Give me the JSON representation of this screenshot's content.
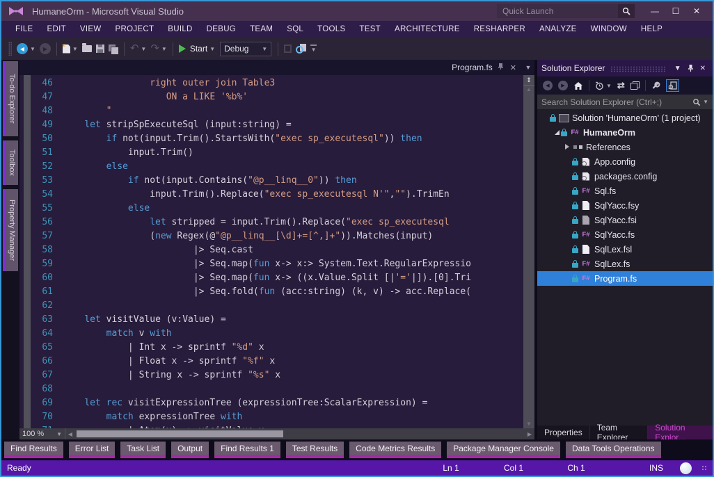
{
  "window": {
    "title": "HumaneOrm - Microsoft Visual Studio"
  },
  "titlebar": {
    "quick_launch": "Quick Launch"
  },
  "menus": [
    "FILE",
    "EDIT",
    "VIEW",
    "PROJECT",
    "BUILD",
    "DEBUG",
    "TEAM",
    "SQL",
    "TOOLS",
    "TEST",
    "ARCHITECTURE",
    "RESHARPER",
    "ANALYZE",
    "WINDOW",
    "HELP"
  ],
  "toolbar": {
    "start_label": "Start",
    "config_value": "Debug"
  },
  "left_tabs": [
    "To-do Explorer",
    "Toolbox",
    "Property Manager"
  ],
  "editor": {
    "tab": "Program.fs",
    "zoom": "100 %",
    "lines": [
      {
        "n": 46,
        "seg": [
          {
            "c": "s",
            "t": "                right outer join Table3"
          }
        ]
      },
      {
        "n": 47,
        "seg": [
          {
            "c": "s",
            "t": "                   ON a LIKE '%b%'"
          }
        ]
      },
      {
        "n": 48,
        "seg": [
          {
            "c": "s",
            "t": "        \""
          }
        ]
      },
      {
        "n": 49,
        "seg": [
          {
            "c": "d",
            "t": "    "
          },
          {
            "c": "k",
            "t": "let"
          },
          {
            "c": "d",
            "t": " stripSpExecuteSql (input:string) ="
          }
        ]
      },
      {
        "n": 50,
        "seg": [
          {
            "c": "d",
            "t": "        "
          },
          {
            "c": "k",
            "t": "if"
          },
          {
            "c": "d",
            "t": " not(input.Trim().StartsWith("
          },
          {
            "c": "s",
            "t": "\"exec sp_executesql\""
          },
          {
            "c": "d",
            "t": ")) "
          },
          {
            "c": "k",
            "t": "then"
          }
        ]
      },
      {
        "n": 51,
        "seg": [
          {
            "c": "d",
            "t": "            input.Trim()"
          }
        ]
      },
      {
        "n": 52,
        "seg": [
          {
            "c": "d",
            "t": "        "
          },
          {
            "c": "k",
            "t": "else"
          }
        ]
      },
      {
        "n": 53,
        "seg": [
          {
            "c": "d",
            "t": "            "
          },
          {
            "c": "k",
            "t": "if"
          },
          {
            "c": "d",
            "t": " not(input.Contains("
          },
          {
            "c": "s",
            "t": "\"@p__linq__0\""
          },
          {
            "c": "d",
            "t": ")) "
          },
          {
            "c": "k",
            "t": "then"
          }
        ]
      },
      {
        "n": 54,
        "seg": [
          {
            "c": "d",
            "t": "                input.Trim().Replace("
          },
          {
            "c": "s",
            "t": "\"exec sp_executesql N'\""
          },
          {
            "c": "d",
            "t": ","
          },
          {
            "c": "s",
            "t": "\"\""
          },
          {
            "c": "d",
            "t": ").TrimEn"
          }
        ]
      },
      {
        "n": 55,
        "seg": [
          {
            "c": "d",
            "t": "            "
          },
          {
            "c": "k",
            "t": "else"
          }
        ]
      },
      {
        "n": 56,
        "seg": [
          {
            "c": "d",
            "t": "                "
          },
          {
            "c": "k",
            "t": "let"
          },
          {
            "c": "d",
            "t": " stripped = input.Trim().Replace("
          },
          {
            "c": "s",
            "t": "\"exec sp_executesql"
          }
        ]
      },
      {
        "n": 57,
        "seg": [
          {
            "c": "d",
            "t": "                ("
          },
          {
            "c": "k",
            "t": "new"
          },
          {
            "c": "d",
            "t": " Regex(@"
          },
          {
            "c": "s",
            "t": "\"@p__linq__[\\d]+=[^,]+\""
          },
          {
            "c": "d",
            "t": ")).Matches(input)"
          }
        ]
      },
      {
        "n": 58,
        "seg": [
          {
            "c": "d",
            "t": "                        |> Seq.cast"
          }
        ]
      },
      {
        "n": 59,
        "seg": [
          {
            "c": "d",
            "t": "                        |> Seq.map("
          },
          {
            "c": "k",
            "t": "fun"
          },
          {
            "c": "d",
            "t": " x-> x:> System.Text.RegularExpressio"
          }
        ]
      },
      {
        "n": 60,
        "seg": [
          {
            "c": "d",
            "t": "                        |> Seq.map("
          },
          {
            "c": "k",
            "t": "fun"
          },
          {
            "c": "d",
            "t": " x-> ((x.Value.Split [|"
          },
          {
            "c": "s",
            "t": "'='"
          },
          {
            "c": "d",
            "t": "|]).[0].Tri"
          }
        ]
      },
      {
        "n": 61,
        "seg": [
          {
            "c": "d",
            "t": "                        |> Seq.fold("
          },
          {
            "c": "k",
            "t": "fun"
          },
          {
            "c": "d",
            "t": " (acc:string) (k, v) -> acc.Replace("
          }
        ]
      },
      {
        "n": 62,
        "seg": []
      },
      {
        "n": 63,
        "seg": [
          {
            "c": "d",
            "t": "    "
          },
          {
            "c": "k",
            "t": "let"
          },
          {
            "c": "d",
            "t": " visitValue (v:Value) ="
          }
        ]
      },
      {
        "n": 64,
        "seg": [
          {
            "c": "d",
            "t": "        "
          },
          {
            "c": "k",
            "t": "match"
          },
          {
            "c": "d",
            "t": " v "
          },
          {
            "c": "k",
            "t": "with"
          }
        ]
      },
      {
        "n": 65,
        "seg": [
          {
            "c": "d",
            "t": "            | Int x -> sprintf "
          },
          {
            "c": "s",
            "t": "\"%d\""
          },
          {
            "c": "d",
            "t": " x"
          }
        ]
      },
      {
        "n": 66,
        "seg": [
          {
            "c": "d",
            "t": "            | Float x -> sprintf "
          },
          {
            "c": "s",
            "t": "\"%f\""
          },
          {
            "c": "d",
            "t": " x"
          }
        ]
      },
      {
        "n": 67,
        "seg": [
          {
            "c": "d",
            "t": "            | String x -> sprintf "
          },
          {
            "c": "s",
            "t": "\"%s\""
          },
          {
            "c": "d",
            "t": " x"
          }
        ]
      },
      {
        "n": 68,
        "seg": []
      },
      {
        "n": 69,
        "seg": [
          {
            "c": "d",
            "t": "    "
          },
          {
            "c": "k",
            "t": "let rec"
          },
          {
            "c": "d",
            "t": " visitExpressionTree (expressionTree:ScalarExpression) ="
          }
        ]
      },
      {
        "n": 70,
        "seg": [
          {
            "c": "d",
            "t": "        "
          },
          {
            "c": "k",
            "t": "match"
          },
          {
            "c": "d",
            "t": " expressionTree "
          },
          {
            "c": "k",
            "t": "with"
          }
        ]
      },
      {
        "n": 71,
        "seg": [
          {
            "c": "d",
            "t": "            | Atom(x) -> visitValue x"
          }
        ]
      }
    ]
  },
  "solution_explorer": {
    "title": "Solution Explorer",
    "search_placeholder": "Search Solution Explorer (Ctrl+;)",
    "tree": [
      {
        "label": "Solution 'HumaneOrm' (1 project)",
        "icon": "solution",
        "indent": 0,
        "lock": true
      },
      {
        "label": "HumaneOrm",
        "icon": "fsproj",
        "indent": 1,
        "expander": "expanded",
        "lock": true,
        "bold": true
      },
      {
        "label": "References",
        "icon": "references",
        "indent": 2,
        "expander": "collapsed",
        "lock": false
      },
      {
        "label": "App.config",
        "icon": "config",
        "indent": 2,
        "lock": true
      },
      {
        "label": "packages.config",
        "icon": "config",
        "indent": 2,
        "lock": true
      },
      {
        "label": "Sql.fs",
        "icon": "fsharp",
        "indent": 2,
        "lock": true
      },
      {
        "label": "SqlYacc.fsy",
        "icon": "file",
        "indent": 2,
        "lock": true
      },
      {
        "label": "SqlYacc.fsi",
        "icon": "file-grey",
        "indent": 2,
        "lock": true
      },
      {
        "label": "SqlYacc.fs",
        "icon": "fsharp",
        "indent": 2,
        "lock": true
      },
      {
        "label": "SqlLex.fsl",
        "icon": "file",
        "indent": 2,
        "lock": true
      },
      {
        "label": "SqlLex.fs",
        "icon": "fsharp",
        "indent": 2,
        "lock": true
      },
      {
        "label": "Program.fs",
        "icon": "fsharp",
        "indent": 2,
        "lock": true,
        "selected": true
      }
    ],
    "bottom_tabs": [
      {
        "label": "Properties",
        "active": false
      },
      {
        "label": "Team Explorer",
        "active": false
      },
      {
        "label": "Solution Explor...",
        "active": true
      }
    ]
  },
  "bottom_panel_tabs": [
    "Find Results",
    "Error List",
    "Task List",
    "Output",
    "Find Results 1",
    "Test Results",
    "Code Metrics Results",
    "Package Manager Console",
    "Data Tools Operations"
  ],
  "statusbar": {
    "ready": "Ready",
    "ln": "Ln 1",
    "col": "Col 1",
    "ch": "Ch 1",
    "ins": "INS"
  },
  "colors": {
    "window_border": "#3898D8",
    "titlebar": "#45304F",
    "menubar": "#2E1C49",
    "statusbar": "#5617A8",
    "editor_bg": "#271C3B",
    "keyword": "#569CD6",
    "string": "#D69D85",
    "line_number": "#3E93B8",
    "tree_selection": "#2F80D9",
    "tab_accent": "#A22BA4",
    "lock_badge": "#39A6C6",
    "fsharp_icon": "#C77BDB"
  }
}
